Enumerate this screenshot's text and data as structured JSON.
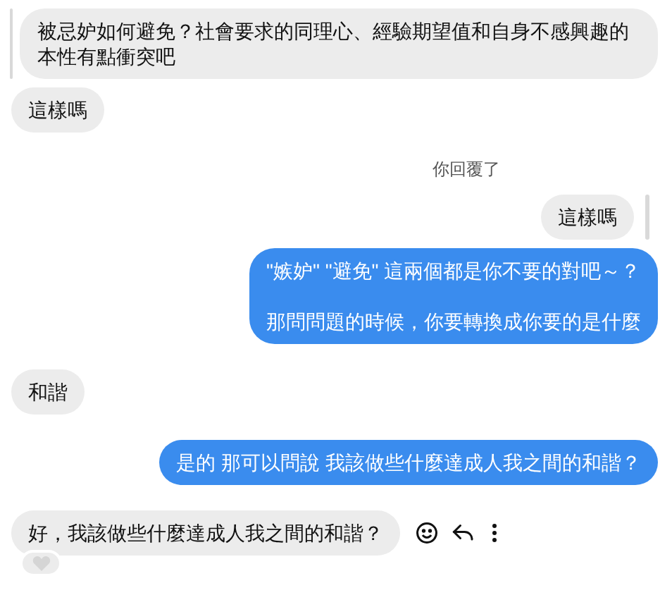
{
  "messages": [
    {
      "kind": "quote_received",
      "text": "被忌妒如何避免？社會要求的同理心、經驗期望值和自身不感興趣的本性有點衝突吧"
    },
    {
      "kind": "received",
      "paragraphs": [
        "這樣嗎"
      ]
    },
    {
      "kind": "reply_label",
      "text": "你回覆了"
    },
    {
      "kind": "quote_sent",
      "text": "這樣嗎"
    },
    {
      "kind": "sent",
      "paragraphs": [
        "\"嫉妒\" \"避免\" 這兩個都是你不要的對吧～？",
        "那問問題的時候，你要轉換成你要的是什麼"
      ]
    },
    {
      "kind": "received",
      "paragraphs": [
        "和諧"
      ]
    },
    {
      "kind": "sent",
      "paragraphs": [
        "是的 那可以問說 我該做些什麼達成人我之間的和諧？"
      ]
    },
    {
      "kind": "received",
      "paragraphs": [
        "好，我該做些什麼達成人我之間的和諧？"
      ],
      "show_actions": true,
      "reacted": true
    }
  ]
}
